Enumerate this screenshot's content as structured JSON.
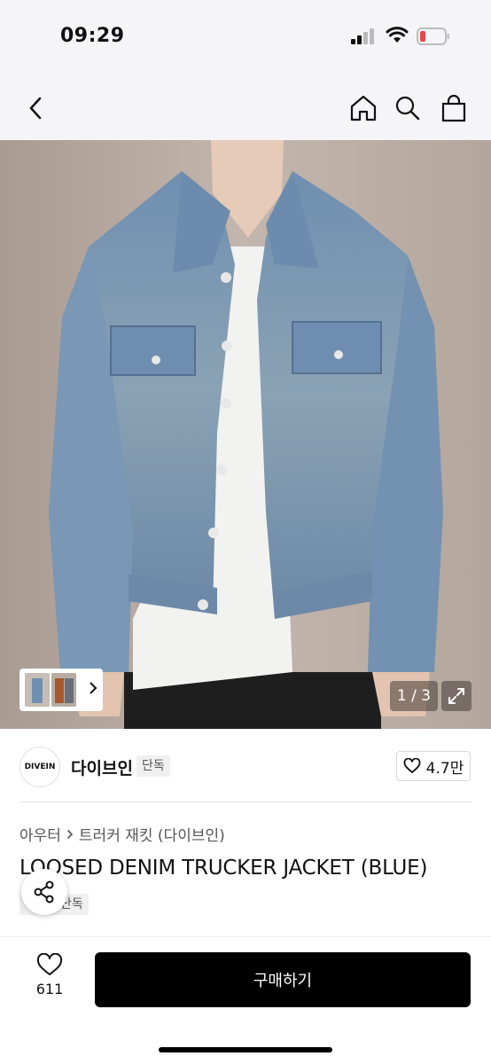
{
  "status_bar": {
    "time": "09:29"
  },
  "nav": {
    "back_icon": "chevron-left-icon",
    "home_icon": "home-icon",
    "search_icon": "search-icon",
    "bag_icon": "shopping-bag-icon"
  },
  "gallery": {
    "counter": "1 / 3",
    "expand_icon": "expand-icon"
  },
  "brand": {
    "logo_text": "DIVEIN",
    "name": "다이브인",
    "badge": "단독",
    "likes": "4.7만"
  },
  "product": {
    "breadcrumb": [
      "아우터",
      "트러커 재킷 (다이브인)"
    ],
    "title": "LOOSED DENIM TRUCKER JACKET (BLUE)",
    "exclusive_badge": "단독"
  },
  "bottom_bar": {
    "wish_count": "611",
    "buy_label": "구매하기"
  },
  "colors": {
    "accent": "#000000",
    "background": "#ffffff",
    "battery_low": "#e5484d"
  }
}
